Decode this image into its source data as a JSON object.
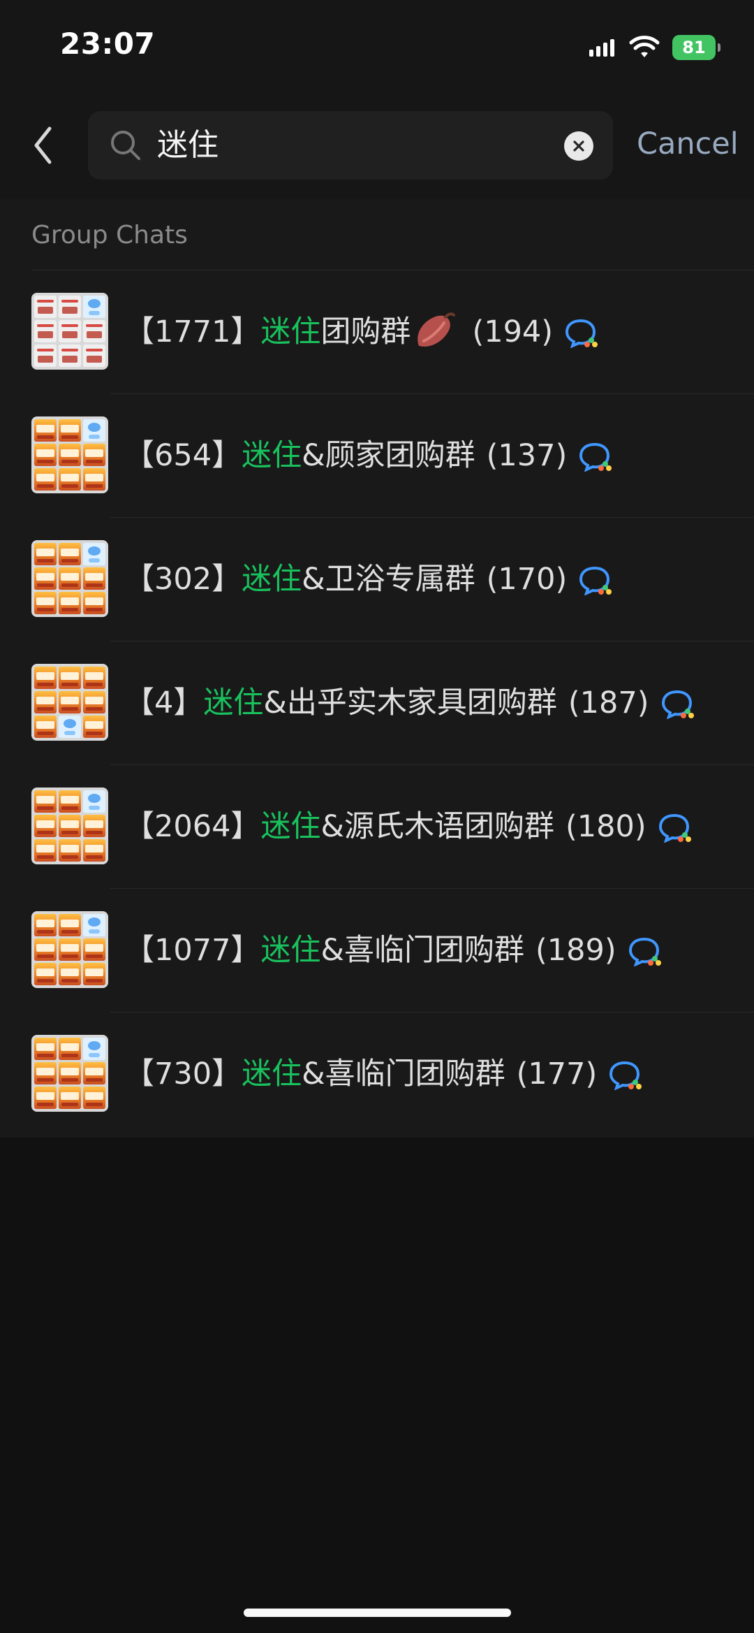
{
  "status_bar": {
    "time": "23:07",
    "battery_level": "81",
    "signal_icon": "cellular-signal-icon",
    "wifi_icon": "wifi-icon"
  },
  "search": {
    "query": "迷住",
    "cancel_label": "Cancel"
  },
  "section": {
    "title": "Group Chats"
  },
  "groups": [
    {
      "prefix": "【1771】",
      "highlight": "迷住",
      "suffix": "团购群",
      "emoji": "sweet-potato-icon",
      "count": "(194)"
    },
    {
      "prefix": "【654】",
      "highlight": "迷住",
      "suffix": "&顾家团购群",
      "count": "(137)"
    },
    {
      "prefix": "【302】",
      "highlight": "迷住",
      "suffix": "&卫浴专属群",
      "count": "(170)"
    },
    {
      "prefix": "【4】",
      "highlight": "迷住",
      "suffix": "&出乎实木家具团购群",
      "count": "(187)"
    },
    {
      "prefix": "【2064】",
      "highlight": "迷住",
      "suffix": "&源氏木语团购群",
      "count": "(180)"
    },
    {
      "prefix": "【1077】",
      "highlight": "迷住",
      "suffix": "&喜临门团购群",
      "count": "(189)"
    },
    {
      "prefix": "【730】",
      "highlight": "迷住",
      "suffix": "&喜临门团购群",
      "count": "(177)"
    }
  ],
  "colors": {
    "highlight": "#19c15d",
    "cancel": "#98aac0",
    "battery": "#43c463",
    "background": "#111111",
    "panel": "#191919"
  }
}
